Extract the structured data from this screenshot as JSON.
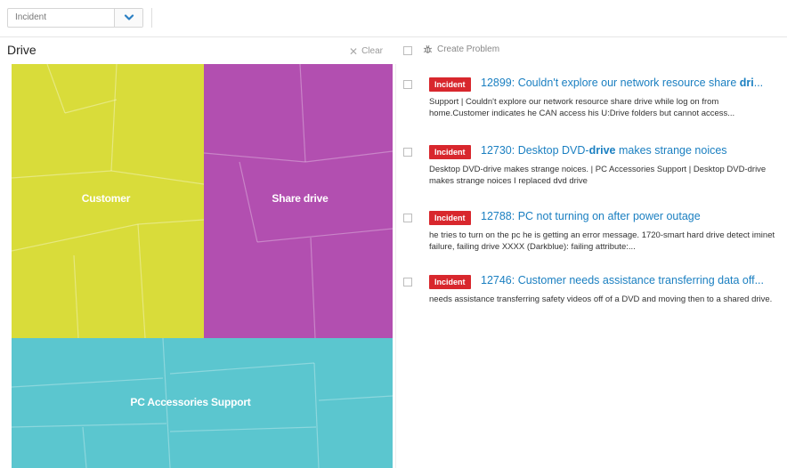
{
  "filter": {
    "selected": "Incident"
  },
  "panel": {
    "title": "Drive",
    "clear_label": "Clear"
  },
  "treemap": {
    "tiles": [
      {
        "label": "Customer",
        "color": "#d9dc3a"
      },
      {
        "label": "Share drive",
        "color": "#b24fb0"
      },
      {
        "label": "PC Accessories Support",
        "color": "#5bc6cf"
      }
    ]
  },
  "results_header": {
    "create_label": "Create Problem"
  },
  "results": [
    {
      "badge": "Incident",
      "title_pre": "12899: Couldn't explore our network resource share ",
      "title_highlight": "dri",
      "title_post": "...",
      "description": "Support | Couldn't explore our network resource share drive while log on from home.Customer indicates he CAN access his U:Drive folders but cannot access..."
    },
    {
      "badge": "Incident",
      "title_pre": "12730: Desktop DVD-",
      "title_highlight": "drive",
      "title_post": " makes strange noices",
      "description": "Desktop DVD-drive makes strange noices. | PC Accessories Support | Desktop DVD-drive makes strange noices I replaced dvd drive"
    },
    {
      "badge": "Incident",
      "title_pre": "12788: PC not turning on after power outage",
      "title_highlight": "",
      "title_post": "",
      "description": "he tries to turn on the pc he is getting an error message. 1720-smart hard drive detect iminet failure, failing drive XXXX (Darkblue): failing attribute:..."
    },
    {
      "badge": "Incident",
      "title_pre": "12746: Customer needs assistance transferring data off...",
      "title_highlight": "",
      "title_post": "",
      "description": "needs assistance transferring safety videos off of a DVD and moving then to a shared drive."
    }
  ]
}
